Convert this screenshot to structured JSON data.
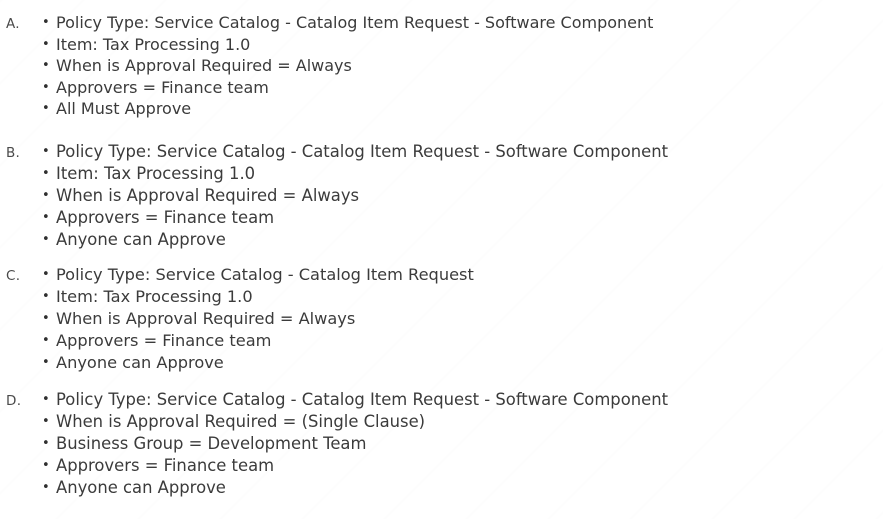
{
  "document": {
    "kind": "multiple-choice-answer-options",
    "background_color": "#ffffff",
    "text_color": "#3b3b3b",
    "bullet_glyph": "•"
  },
  "options": [
    {
      "letter": "A.",
      "bullets": [
        "Policy Type: Service Catalog - Catalog Item Request - Software Component",
        "Item: Tax Processing 1.0",
        "When is Approval Required = Always",
        "Approvers = Finance team",
        "All Must Approve"
      ]
    },
    {
      "letter": "B.",
      "bullets": [
        "Policy Type: Service Catalog - Catalog Item Request - Software Component",
        "Item: Tax Processing 1.0",
        "When is Approval Required = Always",
        "Approvers = Finance team",
        "Anyone can Approve"
      ]
    },
    {
      "letter": "C.",
      "bullets": [
        "Policy Type: Service Catalog - Catalog Item Request",
        "Item: Tax Processing 1.0",
        "When is Approval Required = Always",
        "Approvers = Finance team",
        "Anyone can Approve"
      ]
    },
    {
      "letter": "D.",
      "bullets": [
        "Policy Type: Service Catalog - Catalog Item Request - Software Component",
        "When is Approval Required = (Single Clause)",
        "Business Group = Development Team",
        "Approvers = Finance team",
        "Anyone can Approve"
      ]
    }
  ]
}
